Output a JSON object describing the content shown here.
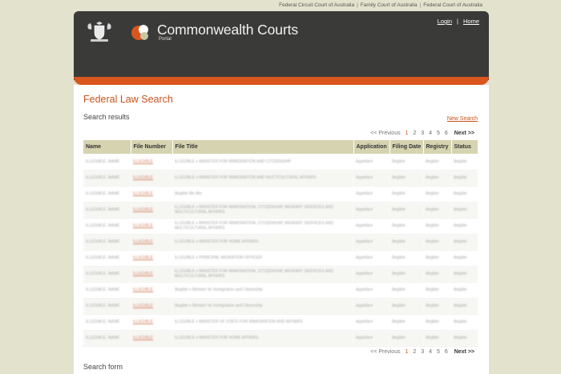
{
  "top_links": [
    "Federal Circuit Court of Australia",
    "Family Court of Australia",
    "Federal Court of Australia"
  ],
  "header": {
    "title": "Commonwealth Courts",
    "subtitle": "Portal",
    "login": "Login",
    "home": "Home"
  },
  "colors": {
    "accent": "#c8531c",
    "header_bg": "#3a3a39",
    "page_bg": "#e3e2cc"
  },
  "page": {
    "title": "Federal Law Search",
    "subtitle": "Search results",
    "new_search": "New Search",
    "search_form": "Search form"
  },
  "pager": {
    "previous": "<< Previous",
    "pages": [
      "1",
      "2",
      "3",
      "4",
      "5",
      "6"
    ],
    "current": "1",
    "next": "Next >>"
  },
  "table": {
    "columns": [
      "Name",
      "File Number",
      "File Title",
      "Application",
      "Filing Date",
      "Registry",
      "Status"
    ],
    "rows": [
      [
        "ILLEGIBLE, NAME",
        "ILLEGIBLE",
        "ILLEGIBLE v MINISTER FOR IMMIGRATION AND CITIZENSHIP",
        "Appellant",
        "illegible",
        "illegible",
        "illegible"
      ],
      [
        "ILLEGIBLE, NAME",
        "ILLEGIBLE",
        "ILLEGIBLE v MINISTER FOR IMMIGRATION AND MULTICULTURAL AFFAIRS",
        "Appellant",
        "illegible",
        "illegible",
        "illegible"
      ],
      [
        "ILLEGIBLE, NAME",
        "ILLEGIBLE",
        "illegible file title",
        "Appellant",
        "illegible",
        "illegible",
        "illegible"
      ],
      [
        "ILLEGIBLE, NAME",
        "ILLEGIBLE",
        "ILLEGIBLE v MINISTER FOR IMMIGRATION, CITIZENSHIP, MIGRANT SERVICES AND MULTICULTURAL AFFAIRS",
        "Appellant",
        "illegible",
        "illegible",
        "illegible"
      ],
      [
        "ILLEGIBLE, NAME",
        "ILLEGIBLE",
        "ILLEGIBLE v MINISTER FOR IMMIGRATION, CITIZENSHIP, MIGRANT SERVICES AND MULTICULTURAL AFFAIRS",
        "Appellant",
        "illegible",
        "illegible",
        "illegible"
      ],
      [
        "ILLEGIBLE, NAME",
        "ILLEGIBLE",
        "ILLEGIBLE v MINISTER FOR HOME AFFAIRS",
        "Appellant",
        "illegible",
        "illegible",
        "illegible"
      ],
      [
        "ILLEGIBLE, NAME",
        "ILLEGIBLE",
        "ILLEGIBLE v PRINCIPAL MIGRATION OFFICER",
        "Appellant",
        "illegible",
        "illegible",
        "illegible"
      ],
      [
        "ILLEGIBLE, NAME",
        "ILLEGIBLE",
        "ILLEGIBLE v MINISTER FOR IMMIGRATION, CITIZENSHIP, MIGRANT SERVICES AND MULTICULTURAL AFFAIRS",
        "Appellant",
        "illegible",
        "illegible",
        "illegible"
      ],
      [
        "ILLEGIBLE, NAME",
        "ILLEGIBLE",
        "illegible v Minister for Immigration and Citizenship",
        "Appellant",
        "illegible",
        "illegible",
        "illegible"
      ],
      [
        "ILLEGIBLE, NAME",
        "ILLEGIBLE",
        "illegible v Minister for Immigration and Citizenship",
        "Appellant",
        "illegible",
        "illegible",
        "illegible"
      ],
      [
        "ILLEGIBLE, NAME",
        "ILLEGIBLE",
        "ILLEGIBLE v MINISTER OF STATE FOR IMMIGRATION AND AFFAIRS",
        "Appellant",
        "illegible",
        "illegible",
        "illegible"
      ],
      [
        "ILLEGIBLE, NAME",
        "ILLEGIBLE",
        "ILLEGIBLE v MINISTER FOR HOME AFFAIRS",
        "Appellant",
        "illegible",
        "illegible",
        "illegible"
      ]
    ]
  }
}
